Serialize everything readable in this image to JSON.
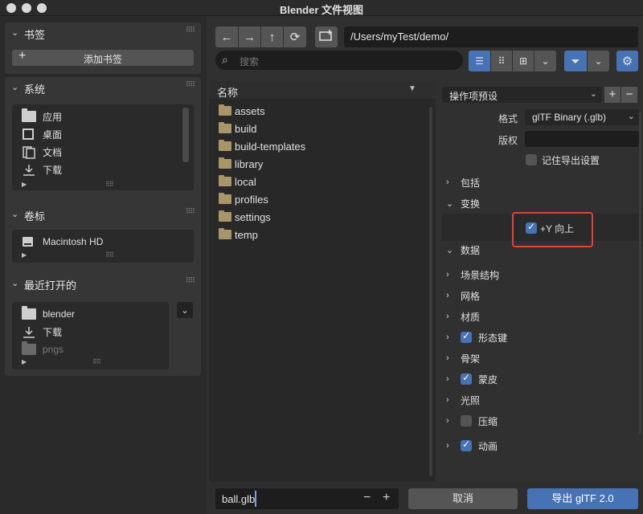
{
  "window": {
    "title": "Blender 文件视图"
  },
  "sidebar": {
    "bookmarks": {
      "title": "书签",
      "add_label": "添加书签"
    },
    "system": {
      "title": "系统",
      "items": [
        {
          "label": "应用",
          "icon": "folder-icon"
        },
        {
          "label": "桌面",
          "icon": "desktop-icon"
        },
        {
          "label": "文档",
          "icon": "documents-icon"
        },
        {
          "label": "下载",
          "icon": "download-icon"
        }
      ]
    },
    "volumes": {
      "title": "卷标",
      "items": [
        {
          "label": "Macintosh HD",
          "icon": "disk-icon"
        }
      ]
    },
    "recent": {
      "title": "最近打开的",
      "items": [
        {
          "label": "blender",
          "icon": "folder-icon"
        },
        {
          "label": "下载",
          "icon": "download-icon"
        },
        {
          "label": "pngs",
          "icon": "folder-icon"
        }
      ]
    }
  },
  "toolbar": {
    "path": "/Users/myTest/demo/",
    "search_placeholder": "搜索"
  },
  "filelist": {
    "header": "名称",
    "files": [
      "assets",
      "build",
      "build-templates",
      "library",
      "local",
      "profiles",
      "settings",
      "temp"
    ]
  },
  "options": {
    "preset_label": "操作项预设",
    "format_label": "格式",
    "format_value": "glTF Binary (.glb)",
    "copyright_label": "版权",
    "copyright_value": "",
    "remember_label": "记住导出设置",
    "remember_checked": false,
    "sections": {
      "include": "包括",
      "transform": "变换",
      "y_up": "+Y 向上",
      "y_up_checked": true,
      "data": "数据",
      "scene_graph": "场景结构",
      "mesh": "网格",
      "material": "材质",
      "shape_keys": "形态键",
      "shape_keys_checked": true,
      "armature": "骨架",
      "skinning": "蒙皮",
      "skinning_checked": true,
      "lighting": "光照",
      "compression": "压缩",
      "compression_checked": false,
      "animation": "动画",
      "animation_checked": true
    }
  },
  "bottom": {
    "filename": "ball.glb",
    "cancel_label": "取消",
    "export_label": "导出 glTF 2.0"
  },
  "colors": {
    "accent": "#4772b3",
    "highlight_border": "#e0453a"
  }
}
